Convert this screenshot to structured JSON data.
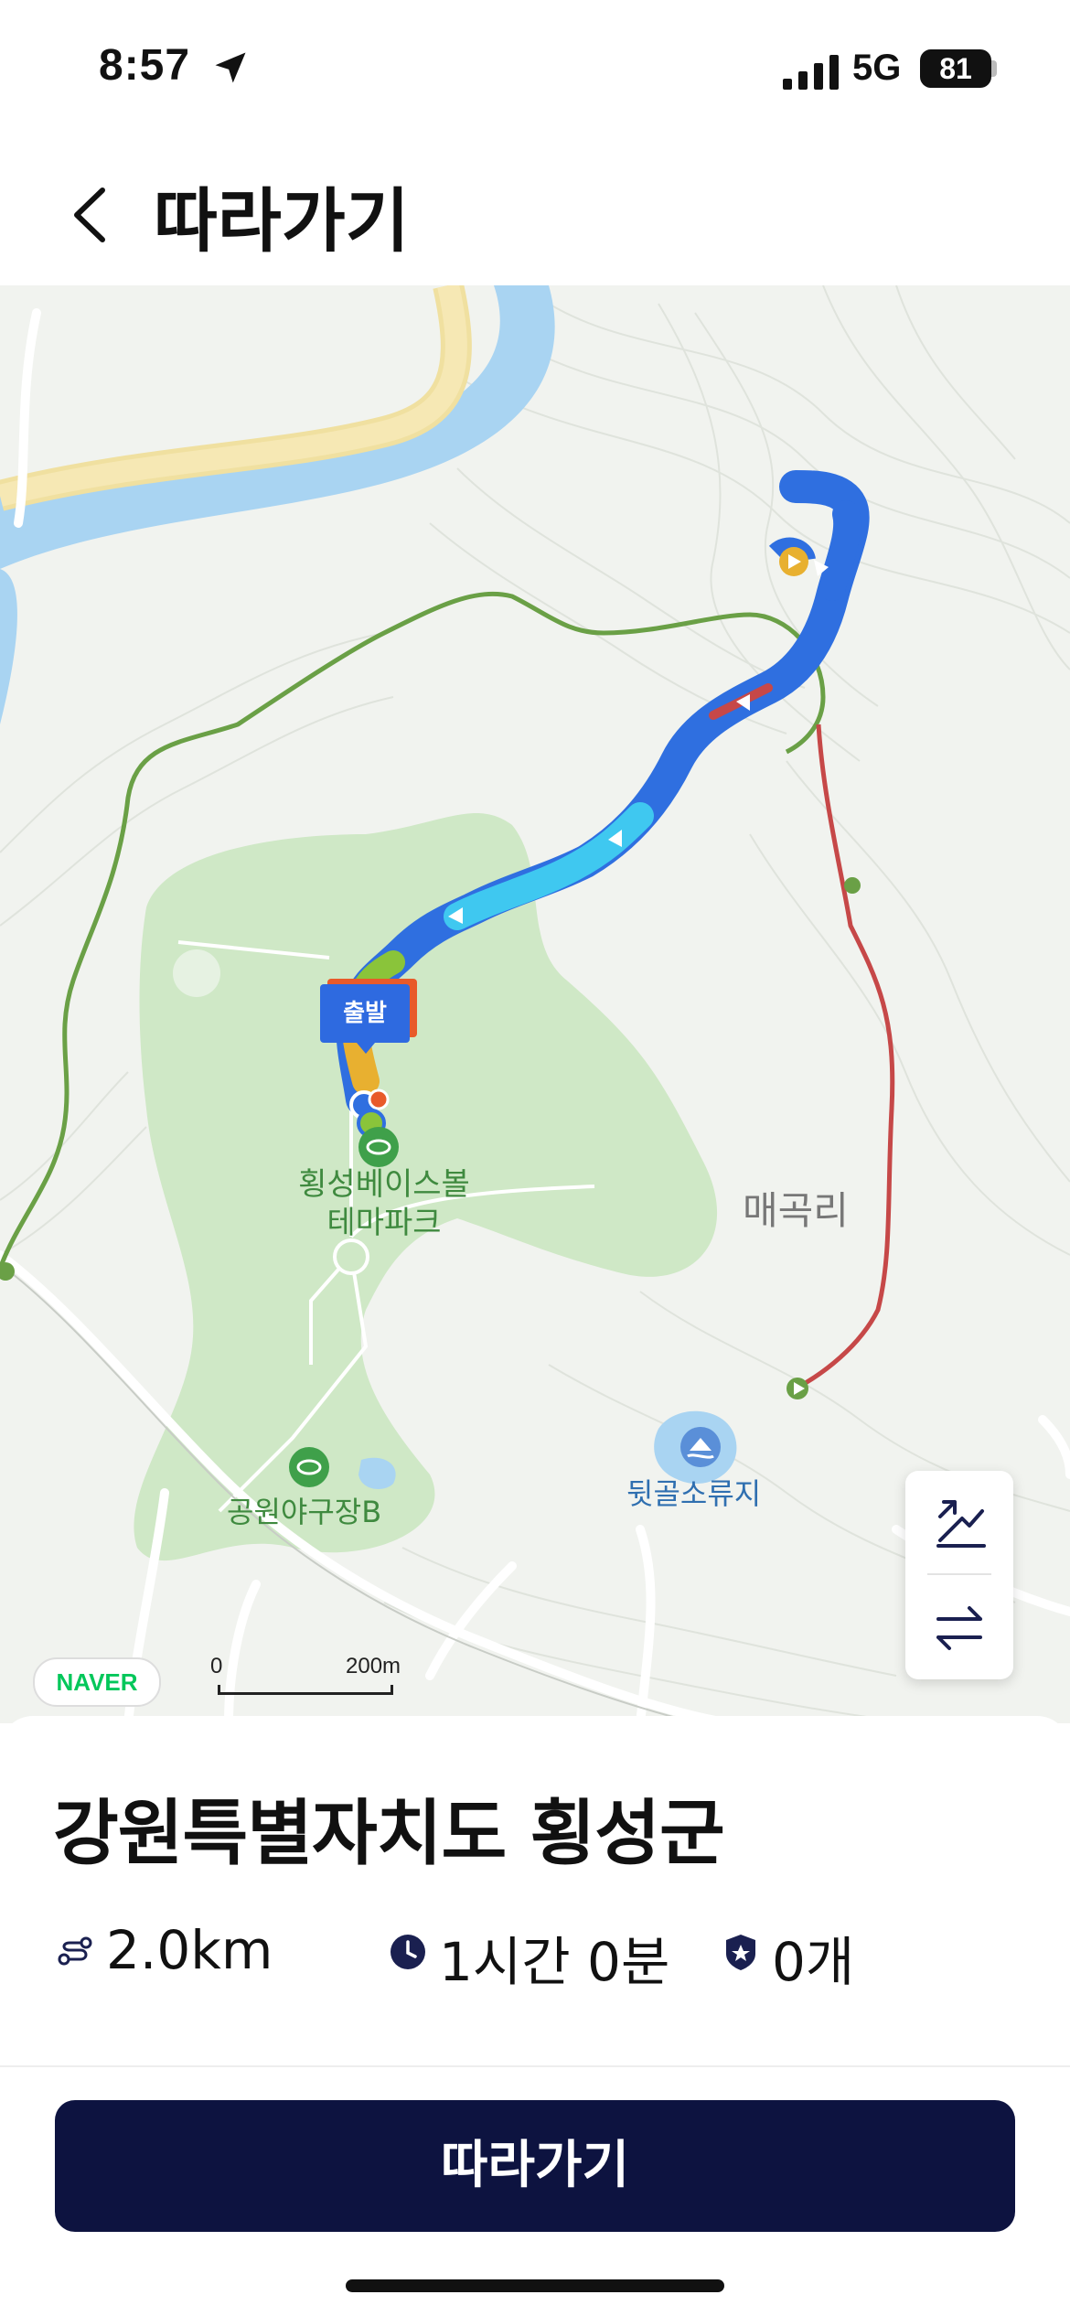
{
  "status_bar": {
    "time": "8:57",
    "network": "5G",
    "battery": "81"
  },
  "header": {
    "title": "따라가기"
  },
  "map": {
    "start_badge": "출발",
    "park_label_line1": "횡성베이스볼",
    "park_label_line2": "테마파크",
    "village_label": "매곡리",
    "reservoir_label": "뒷골소류지",
    "campground_label": "공원야구장B",
    "logo_text": "NAVER",
    "scale_zero": "0",
    "scale_distance": "200m",
    "controls": {
      "top_icon": "altitude-chart-icon",
      "bottom_icon": "swap-direction-icon"
    },
    "colors": {
      "route_main": "#2f6fe0",
      "route_light": "#3fc8f0",
      "return_path": "#c64848",
      "trail": "#6aa046",
      "park": "#cfe8c6",
      "water": "#a9d4f2",
      "road_yellow": "#f6e4a4"
    }
  },
  "sheet": {
    "region": "강원특별자치도 횡성군",
    "distance": "2.0km",
    "duration": "1시간 0분",
    "badges": "0개",
    "follow_button": "따라가기"
  }
}
